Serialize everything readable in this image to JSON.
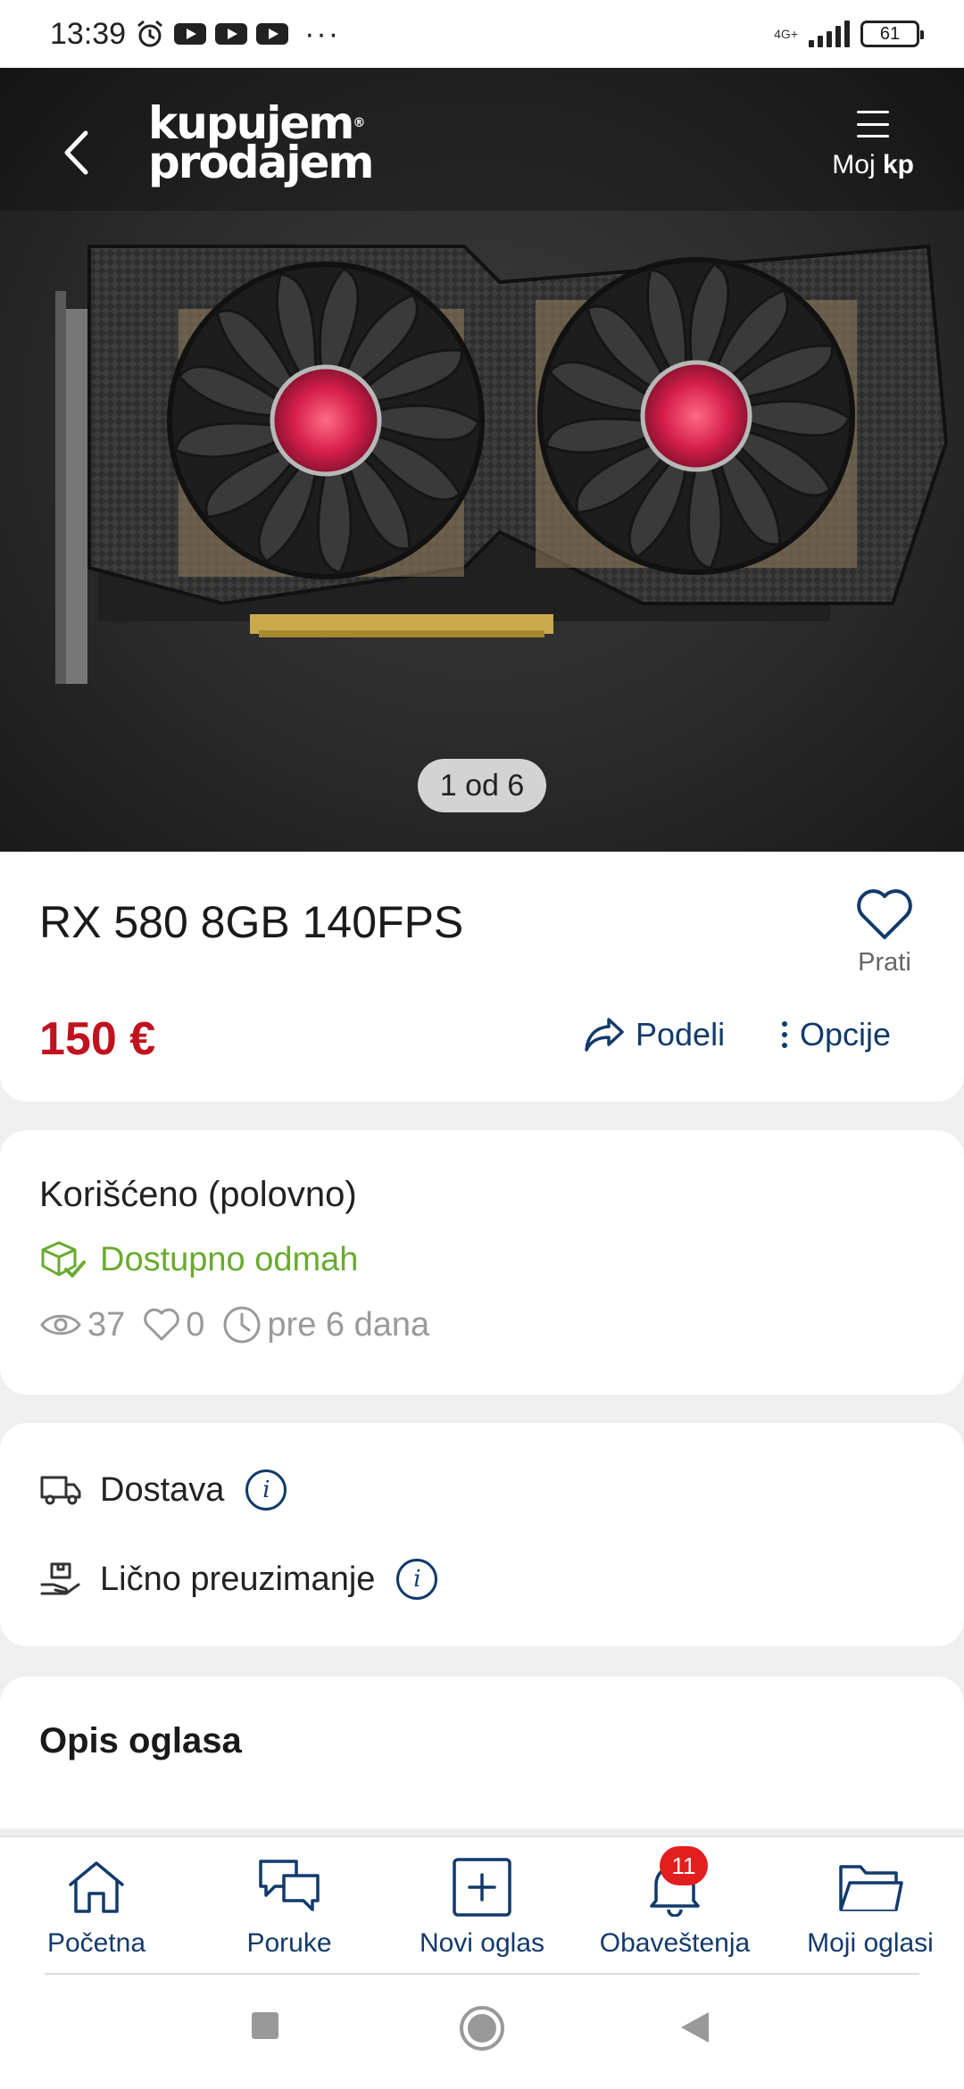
{
  "status_bar": {
    "time": "13:39",
    "network": "4G+",
    "battery": "61",
    "overflow": "···"
  },
  "header": {
    "logo_line1": "kupujem",
    "logo_line2": "prodajem",
    "logo_mark": "®",
    "menu_label_prefix": "Moj ",
    "menu_label_bold": "kp"
  },
  "gallery": {
    "counter": "1 od 6"
  },
  "listing": {
    "title": "RX 580 8GB 140FPS",
    "follow_label": "Prati",
    "price": "150 €",
    "share_label": "Podeli",
    "options_label": "Opcije"
  },
  "info": {
    "condition": "Korišćeno (polovno)",
    "availability": "Dostupno odmah",
    "views": "37",
    "likes": "0",
    "posted": "pre 6 dana"
  },
  "delivery": {
    "shipping": "Dostava",
    "pickup": "Lično preuzimanje"
  },
  "description": {
    "title": "Opis oglasa"
  },
  "bottom_nav": {
    "items": [
      {
        "label": "Početna",
        "icon": "home-icon"
      },
      {
        "label": "Poruke",
        "icon": "chat-icon"
      },
      {
        "label": "Novi oglas",
        "icon": "plus-square-icon"
      },
      {
        "label": "Obaveštenja",
        "icon": "bell-icon",
        "badge": "11"
      },
      {
        "label": "Moji oglasi",
        "icon": "folder-icon"
      }
    ]
  },
  "colors": {
    "brand_blue": "#123a6b",
    "price_red": "#c1121f",
    "available_green": "#6aaa2e",
    "badge_red": "#e21f1f"
  }
}
